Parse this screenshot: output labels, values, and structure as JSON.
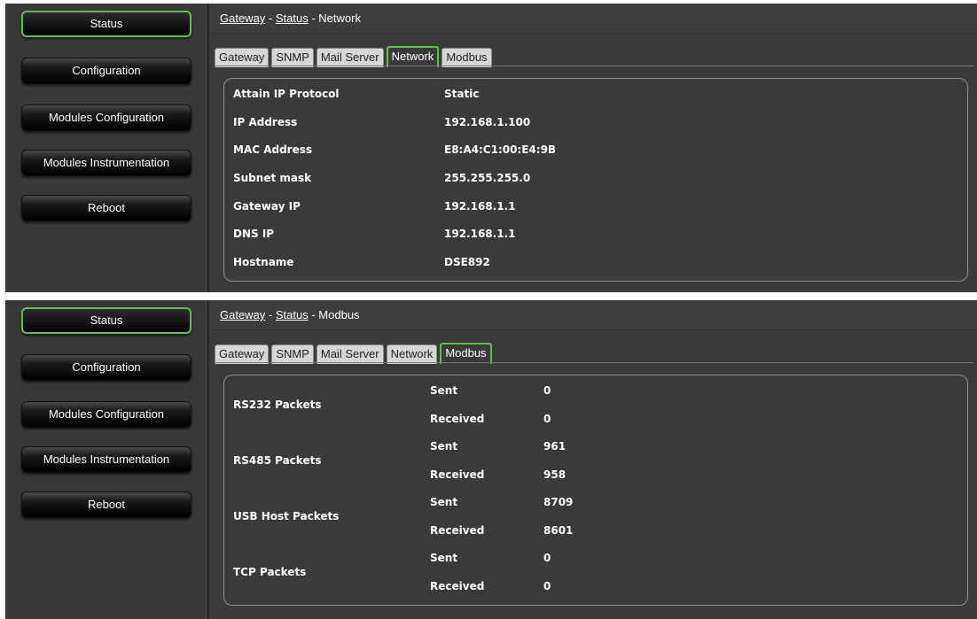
{
  "nav": [
    "Status",
    "Configuration",
    "Modules Configuration",
    "Modules Instrumentation",
    "Reboot"
  ],
  "tabs": [
    "Gateway",
    "SNMP",
    "Mail Server",
    "Network",
    "Modbus"
  ],
  "network_view": {
    "breadcrumb": {
      "gateway": "Gateway",
      "status": "Status",
      "sep": " - ",
      "current": "Network"
    },
    "active_tab": "Network",
    "rows": [
      {
        "label": "Attain IP Protocol",
        "value": "Static"
      },
      {
        "label": "IP Address",
        "value": "192.168.1.100"
      },
      {
        "label": "MAC Address",
        "value": "E8:A4:C1:00:E4:9B"
      },
      {
        "label": "Subnet mask",
        "value": "255.255.255.0"
      },
      {
        "label": "Gateway IP",
        "value": "192.168.1.1"
      },
      {
        "label": "DNS IP",
        "value": "192.168.1.1"
      },
      {
        "label": "Hostname",
        "value": "DSE892"
      }
    ]
  },
  "modbus_view": {
    "breadcrumb": {
      "gateway": "Gateway",
      "status": "Status",
      "sep": " - ",
      "current": "Modbus"
    },
    "active_tab": "Modbus",
    "groups": [
      {
        "name": "RS232 Packets",
        "sent_label": "Sent",
        "sent": "0",
        "received_label": "Received",
        "received": "0"
      },
      {
        "name": "RS485 Packets",
        "sent_label": "Sent",
        "sent": "961",
        "received_label": "Received",
        "received": "958"
      },
      {
        "name": "USB Host Packets",
        "sent_label": "Sent",
        "sent": "8709",
        "received_label": "Received",
        "received": "8601"
      },
      {
        "name": "TCP Packets",
        "sent_label": "Sent",
        "sent": "0",
        "received_label": "Received",
        "received": "0"
      }
    ]
  },
  "colors": {
    "active_outline": "#5ec24a",
    "panel_bg": "#3a3a3a",
    "tab_bg": "#d6d6d6"
  }
}
